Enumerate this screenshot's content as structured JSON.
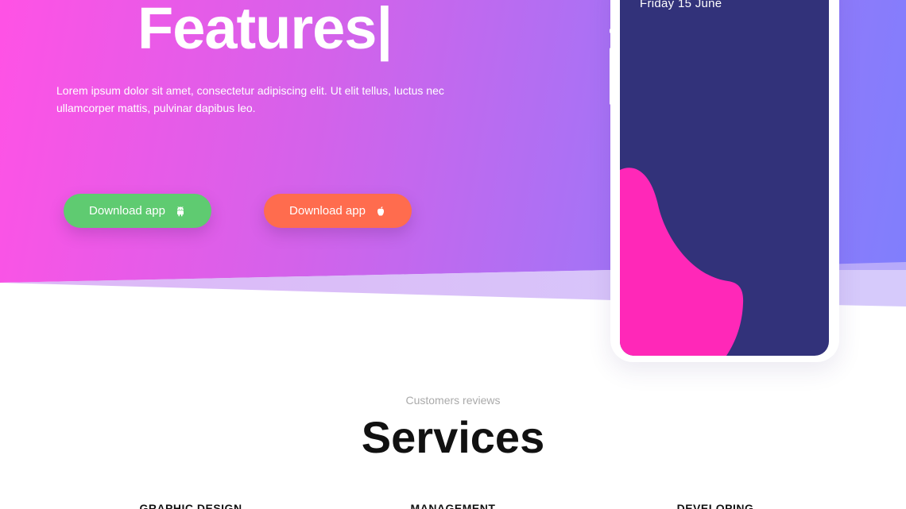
{
  "hero": {
    "title": "Features|",
    "text": "Lorem ipsum dolor sit amet, consectetur adipiscing elit. Ut elit tellus, luctus nec ullamcorper mattis, pulvinar dapibus leo.",
    "buttons": [
      {
        "label": "Download app",
        "icon": "android-icon",
        "color": "#5fcb71"
      },
      {
        "label": "Download app",
        "icon": "apple-icon",
        "color": "#ff6c4e"
      }
    ]
  },
  "phone": {
    "date": "Friday 15 June",
    "screen_color": "#32327a",
    "blob_color": "#ff28b8"
  },
  "services": {
    "kicker": "Customers reviews",
    "title": "Services",
    "items": [
      "GRAPHIC DESIGN",
      "MANAGEMENT",
      "DEVELOPING"
    ]
  },
  "colors": {
    "gradient_start": "#ff52e5",
    "gradient_end": "#7f7ffd"
  }
}
